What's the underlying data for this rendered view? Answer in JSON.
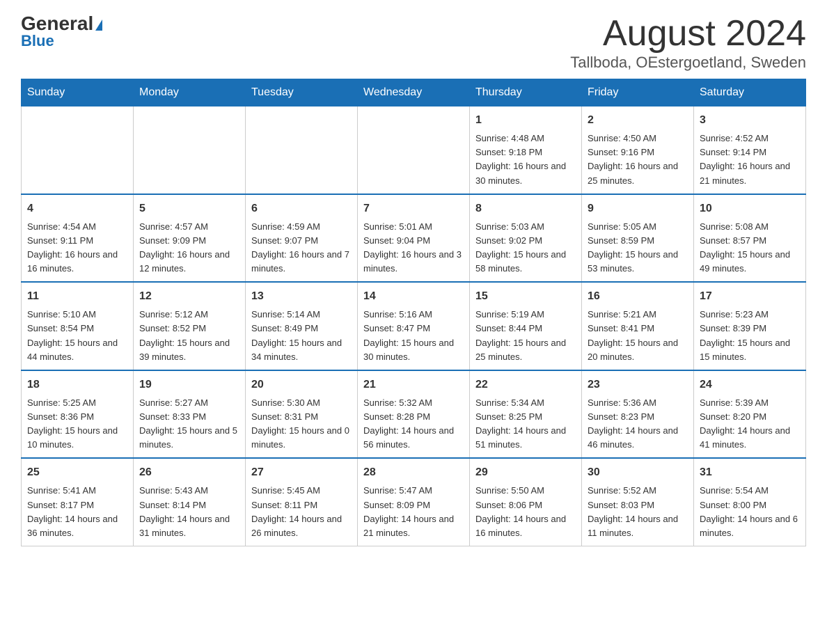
{
  "header": {
    "logo_general": "General",
    "logo_blue": "Blue",
    "month_title": "August 2024",
    "location": "Tallboda, OEstergoetland, Sweden"
  },
  "days_of_week": [
    "Sunday",
    "Monday",
    "Tuesday",
    "Wednesday",
    "Thursday",
    "Friday",
    "Saturday"
  ],
  "weeks": [
    [
      {
        "day": "",
        "info": ""
      },
      {
        "day": "",
        "info": ""
      },
      {
        "day": "",
        "info": ""
      },
      {
        "day": "",
        "info": ""
      },
      {
        "day": "1",
        "info": "Sunrise: 4:48 AM\nSunset: 9:18 PM\nDaylight: 16 hours and 30 minutes."
      },
      {
        "day": "2",
        "info": "Sunrise: 4:50 AM\nSunset: 9:16 PM\nDaylight: 16 hours and 25 minutes."
      },
      {
        "day": "3",
        "info": "Sunrise: 4:52 AM\nSunset: 9:14 PM\nDaylight: 16 hours and 21 minutes."
      }
    ],
    [
      {
        "day": "4",
        "info": "Sunrise: 4:54 AM\nSunset: 9:11 PM\nDaylight: 16 hours and 16 minutes."
      },
      {
        "day": "5",
        "info": "Sunrise: 4:57 AM\nSunset: 9:09 PM\nDaylight: 16 hours and 12 minutes."
      },
      {
        "day": "6",
        "info": "Sunrise: 4:59 AM\nSunset: 9:07 PM\nDaylight: 16 hours and 7 minutes."
      },
      {
        "day": "7",
        "info": "Sunrise: 5:01 AM\nSunset: 9:04 PM\nDaylight: 16 hours and 3 minutes."
      },
      {
        "day": "8",
        "info": "Sunrise: 5:03 AM\nSunset: 9:02 PM\nDaylight: 15 hours and 58 minutes."
      },
      {
        "day": "9",
        "info": "Sunrise: 5:05 AM\nSunset: 8:59 PM\nDaylight: 15 hours and 53 minutes."
      },
      {
        "day": "10",
        "info": "Sunrise: 5:08 AM\nSunset: 8:57 PM\nDaylight: 15 hours and 49 minutes."
      }
    ],
    [
      {
        "day": "11",
        "info": "Sunrise: 5:10 AM\nSunset: 8:54 PM\nDaylight: 15 hours and 44 minutes."
      },
      {
        "day": "12",
        "info": "Sunrise: 5:12 AM\nSunset: 8:52 PM\nDaylight: 15 hours and 39 minutes."
      },
      {
        "day": "13",
        "info": "Sunrise: 5:14 AM\nSunset: 8:49 PM\nDaylight: 15 hours and 34 minutes."
      },
      {
        "day": "14",
        "info": "Sunrise: 5:16 AM\nSunset: 8:47 PM\nDaylight: 15 hours and 30 minutes."
      },
      {
        "day": "15",
        "info": "Sunrise: 5:19 AM\nSunset: 8:44 PM\nDaylight: 15 hours and 25 minutes."
      },
      {
        "day": "16",
        "info": "Sunrise: 5:21 AM\nSunset: 8:41 PM\nDaylight: 15 hours and 20 minutes."
      },
      {
        "day": "17",
        "info": "Sunrise: 5:23 AM\nSunset: 8:39 PM\nDaylight: 15 hours and 15 minutes."
      }
    ],
    [
      {
        "day": "18",
        "info": "Sunrise: 5:25 AM\nSunset: 8:36 PM\nDaylight: 15 hours and 10 minutes."
      },
      {
        "day": "19",
        "info": "Sunrise: 5:27 AM\nSunset: 8:33 PM\nDaylight: 15 hours and 5 minutes."
      },
      {
        "day": "20",
        "info": "Sunrise: 5:30 AM\nSunset: 8:31 PM\nDaylight: 15 hours and 0 minutes."
      },
      {
        "day": "21",
        "info": "Sunrise: 5:32 AM\nSunset: 8:28 PM\nDaylight: 14 hours and 56 minutes."
      },
      {
        "day": "22",
        "info": "Sunrise: 5:34 AM\nSunset: 8:25 PM\nDaylight: 14 hours and 51 minutes."
      },
      {
        "day": "23",
        "info": "Sunrise: 5:36 AM\nSunset: 8:23 PM\nDaylight: 14 hours and 46 minutes."
      },
      {
        "day": "24",
        "info": "Sunrise: 5:39 AM\nSunset: 8:20 PM\nDaylight: 14 hours and 41 minutes."
      }
    ],
    [
      {
        "day": "25",
        "info": "Sunrise: 5:41 AM\nSunset: 8:17 PM\nDaylight: 14 hours and 36 minutes."
      },
      {
        "day": "26",
        "info": "Sunrise: 5:43 AM\nSunset: 8:14 PM\nDaylight: 14 hours and 31 minutes."
      },
      {
        "day": "27",
        "info": "Sunrise: 5:45 AM\nSunset: 8:11 PM\nDaylight: 14 hours and 26 minutes."
      },
      {
        "day": "28",
        "info": "Sunrise: 5:47 AM\nSunset: 8:09 PM\nDaylight: 14 hours and 21 minutes."
      },
      {
        "day": "29",
        "info": "Sunrise: 5:50 AM\nSunset: 8:06 PM\nDaylight: 14 hours and 16 minutes."
      },
      {
        "day": "30",
        "info": "Sunrise: 5:52 AM\nSunset: 8:03 PM\nDaylight: 14 hours and 11 minutes."
      },
      {
        "day": "31",
        "info": "Sunrise: 5:54 AM\nSunset: 8:00 PM\nDaylight: 14 hours and 6 minutes."
      }
    ]
  ]
}
